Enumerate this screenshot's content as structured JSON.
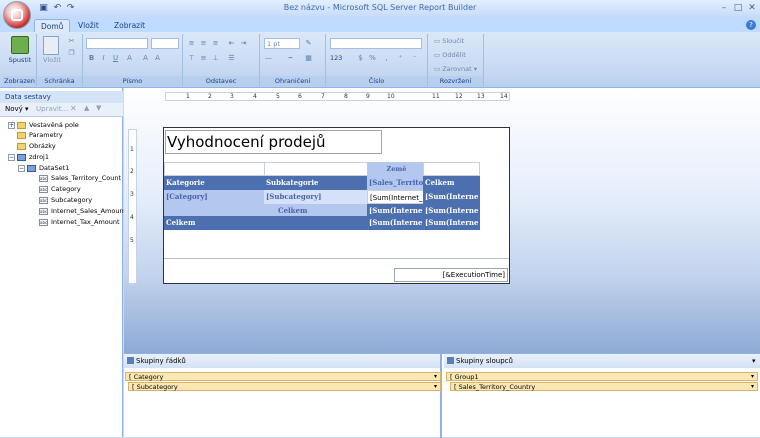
{
  "window": {
    "title": "Bez názvu - Microsoft SQL Server Report Builder"
  },
  "tabs": [
    "Domů",
    "Vložit",
    "Zobrazit"
  ],
  "ribbon": {
    "groups": {
      "view": "Zobrazen",
      "clipboard": "Schránka",
      "font": "Písmo",
      "paragraph": "Odstavec",
      "border": "Ohraničení",
      "number": "Číslo",
      "layout": "Rozvržení"
    },
    "run_label": "Spustit",
    "paste_label": "Vložit",
    "border_width": "1 pt",
    "number_format": "123",
    "merge_label": "Sloučit",
    "split_label": "Oddělit",
    "align_label": "Zarovnat"
  },
  "left_pane": {
    "header": "Data sestavy",
    "new_label": "Nový",
    "edit_label": "Upravit...",
    "tree": {
      "builtin": "Vestavěná pole",
      "params": "Parametry",
      "images": "Obrázky",
      "source": "zdroj1",
      "dataset": "DataSet1",
      "fields": [
        "Sales_Territory_Count",
        "Category",
        "Subcategory",
        "Internet_Sales_Amount",
        "Internet_Tax_Amount"
      ]
    }
  },
  "ruler": {
    "h": [
      "1",
      "2",
      "3",
      "4",
      "5",
      "6",
      "7",
      "8",
      "9",
      "10",
      "11",
      "12",
      "13",
      "14"
    ],
    "v": [
      "1",
      "2",
      "3",
      "4",
      "5"
    ]
  },
  "report": {
    "title": "Vyhodnocení prodejů",
    "matrix": {
      "col_group_header": "Země",
      "r1": [
        "Kategorie",
        "Subkategorie",
        "[Sales_Territo",
        "Celkem"
      ],
      "r2": [
        "[Category]",
        "[Subcategory]",
        "[Sum(Internet_",
        "[Sum(Interne"
      ],
      "r3": [
        "Celkem",
        "[Sum(Interne",
        "[Sum(Interne"
      ],
      "r4": [
        "Celkem",
        "[Sum(Interne",
        "[Sum(Interne"
      ]
    },
    "exec_time": "[&ExecutionTime]"
  },
  "row_groups": {
    "header": "Skupiny řádků",
    "items": [
      "[ Category",
      "[ Subcategory"
    ]
  },
  "col_groups": {
    "header": "Skupiny sloupců",
    "items": [
      "[ Group1",
      "[ Sales_Territory_Country"
    ]
  }
}
